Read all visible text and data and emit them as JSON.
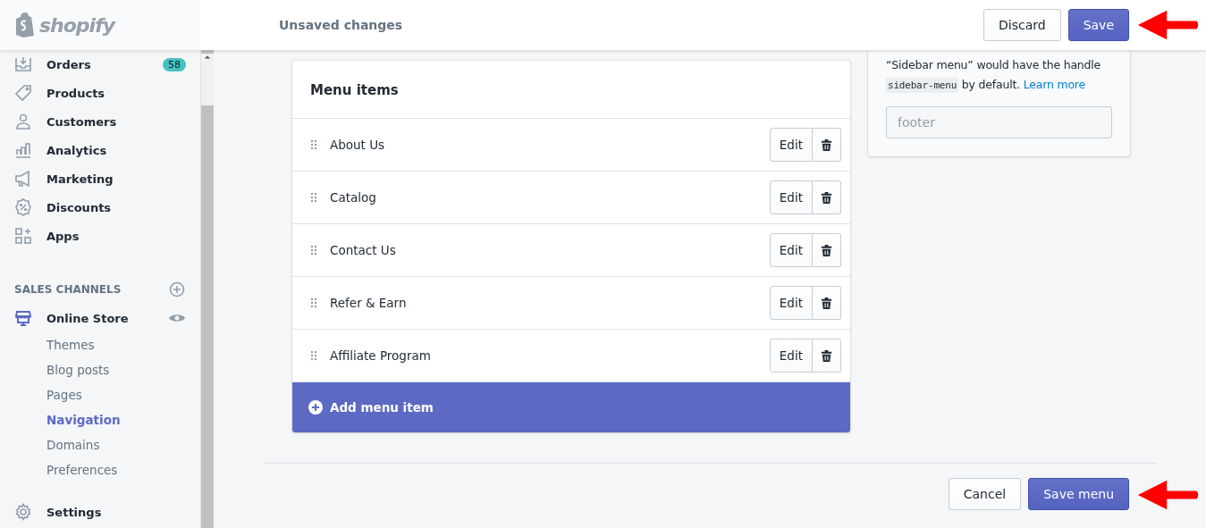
{
  "logo": {
    "text": "shopify"
  },
  "header": {
    "title": "Unsaved changes",
    "buttons": [
      {
        "label": "Discard",
        "kind": "secondary"
      },
      {
        "label": "Save",
        "kind": "primary"
      }
    ]
  },
  "sidebar": {
    "items": [
      {
        "label": "Orders",
        "badge": "58"
      },
      {
        "label": "Products"
      },
      {
        "label": "Customers"
      },
      {
        "label": "Analytics"
      },
      {
        "label": "Marketing"
      },
      {
        "label": "Discounts"
      },
      {
        "label": "Apps"
      }
    ],
    "section": {
      "title": "SALES CHANNELS",
      "channel": {
        "label": "Online Store",
        "children": [
          {
            "label": "Themes",
            "selected": false
          },
          {
            "label": "Blog posts",
            "selected": false
          },
          {
            "label": "Pages",
            "selected": false
          },
          {
            "label": "Navigation",
            "selected": true
          },
          {
            "label": "Domains",
            "selected": false
          },
          {
            "label": "Preferences",
            "selected": false
          }
        ]
      }
    },
    "settings": {
      "label": "Settings"
    }
  },
  "menu_card": {
    "title": "Menu items",
    "items": [
      {
        "label": "About Us",
        "edit": "Edit"
      },
      {
        "label": "Catalog",
        "edit": "Edit"
      },
      {
        "label": "Contact Us",
        "edit": "Edit"
      },
      {
        "label": "Refer & Earn",
        "edit": "Edit"
      },
      {
        "label": "Affiliate Program",
        "edit": "Edit"
      }
    ],
    "add": "Add menu item"
  },
  "handle_card": {
    "text_1": "“Sidebar menu” would have the handle",
    "code": "sidebar-menu",
    "text_2": "by default.",
    "link": "Learn more",
    "placeholder": "footer"
  },
  "footer": {
    "buttons": [
      {
        "label": "Cancel",
        "kind": "secondary"
      },
      {
        "label": "Save menu",
        "kind": "primary"
      }
    ]
  }
}
